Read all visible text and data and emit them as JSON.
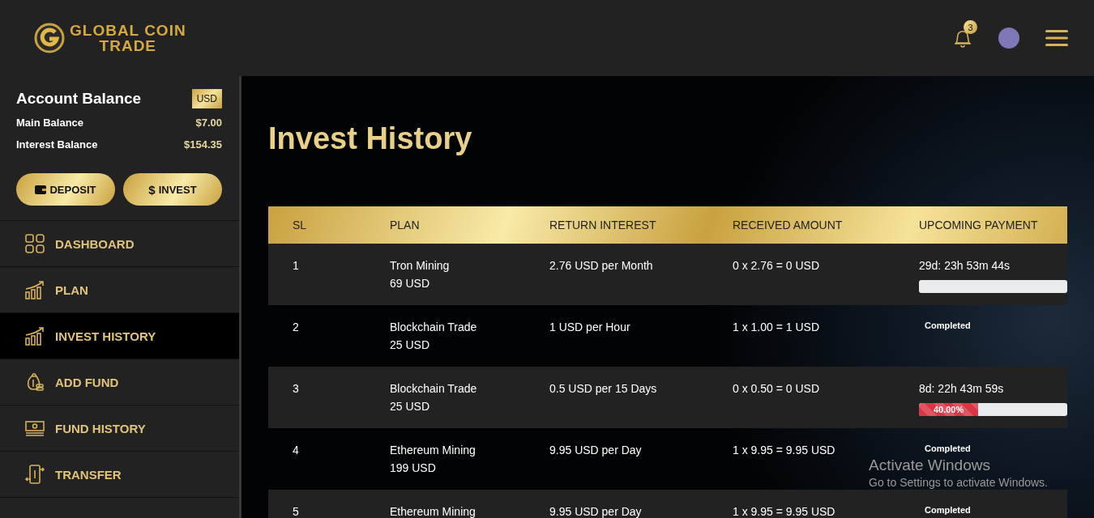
{
  "header": {
    "logo_line1": "GLOBAL COIN",
    "logo_line2": "TRADE",
    "notification_count": "3"
  },
  "balance": {
    "title": "Account Balance",
    "currency": "USD",
    "rows": [
      {
        "label": "Main Balance",
        "value": "$7.00"
      },
      {
        "label": "Interest Balance",
        "value": "$154.35"
      }
    ],
    "buttons": [
      {
        "kind": "deposit",
        "label": "DEPOSIT"
      },
      {
        "kind": "invest",
        "label": "INVEST",
        "symbol": "$"
      }
    ]
  },
  "sidebar": {
    "items": [
      {
        "label": "DASHBOARD",
        "selected": false
      },
      {
        "label": "PLAN",
        "selected": false
      },
      {
        "label": "INVEST HISTORY",
        "selected": true
      },
      {
        "label": "ADD FUND",
        "selected": false
      },
      {
        "label": "FUND HISTORY",
        "selected": false
      },
      {
        "label": "TRANSFER",
        "selected": false
      }
    ]
  },
  "page_title": "Invest History",
  "table": {
    "columns": [
      "SL",
      "PLAN",
      "RETURN INTEREST",
      "RECEIVED AMOUNT",
      "UPCOMING PAYMENT"
    ],
    "rows": [
      {
        "sl": "1",
        "plan": "Tron Mining",
        "amount": "69 USD",
        "interest": "2.76 USD per Month",
        "received": "0 x 2.76 = 0 USD",
        "upcoming": {
          "kind": "countdown",
          "time": "29d: 23h 53m 44s",
          "level": 0
        }
      },
      {
        "sl": "2",
        "plan": "Blockchain Trade",
        "amount": "25 USD",
        "interest": "1 USD per Hour",
        "received": "1 x 1.00 = 1 USD",
        "upcoming": {
          "kind": "completed",
          "label": "Completed"
        }
      },
      {
        "sl": "3",
        "plan": "Blockchain Trade",
        "amount": "25 USD",
        "interest": "0.5 USD per 15 Days",
        "received": "0 x 0.50 = 0 USD",
        "upcoming": {
          "kind": "countdown",
          "time": "8d: 22h 43m 59s",
          "level": 0.4,
          "percent": "40.00%"
        }
      },
      {
        "sl": "4",
        "plan": "Ethereum Mining",
        "amount": "199 USD",
        "interest": "9.95 USD per Day",
        "received": "1 x 9.95 = 9.95 USD",
        "upcoming": {
          "kind": "completed",
          "label": "Completed"
        }
      },
      {
        "sl": "5",
        "plan": "Ethereum Mining",
        "interest": "9.95 USD per Day",
        "received": "1 x 9.95 = 9.95 USD",
        "upcoming": {
          "kind": "completed",
          "label": "Completed"
        }
      }
    ]
  },
  "os_notice": {
    "title": "Activate Windows",
    "subtitle": "Go to Settings to activate Windows."
  }
}
